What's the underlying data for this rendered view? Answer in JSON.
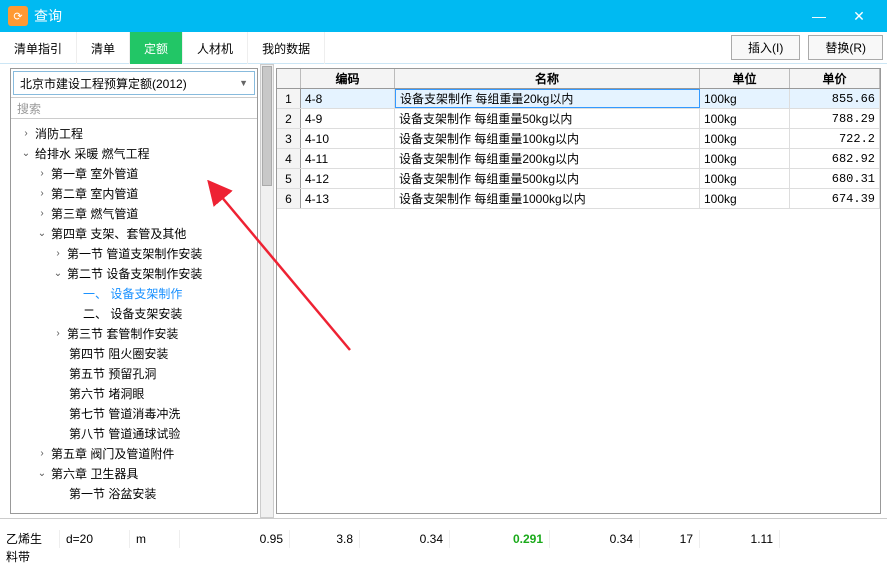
{
  "window": {
    "title": "查询",
    "minimize": "—",
    "close": "✕"
  },
  "tabs": {
    "t1": "清单指引",
    "t2": "清单",
    "t3": "定额",
    "t4": "人材机",
    "t5": "我的数据"
  },
  "actions": {
    "insert": "插入(I)",
    "replace": "替换(R)"
  },
  "dropdown": {
    "value": "北京市建设工程预算定额(2012)"
  },
  "search": {
    "placeholder": "搜索"
  },
  "tree": {
    "n1": "消防工程",
    "n2": "给排水 采暖 燃气工程",
    "n3": "第一章  室外管道",
    "n4": "第二章  室内管道",
    "n5": "第三章  燃气管道",
    "n6": "第四章  支架、套管及其他",
    "n7": "第一节  管道支架制作安装",
    "n8": "第二节  设备支架制作安装",
    "n9": "一、 设备支架制作",
    "n10": "二、 设备支架安装",
    "n11": "第三节  套管制作安装",
    "n12": "第四节  阻火圈安装",
    "n13": "第五节  预留孔洞",
    "n14": "第六节  堵洞眼",
    "n15": "第七节  管道消毒冲洗",
    "n16": "第八节  管道通球试验",
    "n17": "第五章  阀门及管道附件",
    "n18": "第六章  卫生器具",
    "n19": "第一节  浴盆安装"
  },
  "grid": {
    "headers": {
      "num": "",
      "code": "编码",
      "name": "名称",
      "unit": "单位",
      "price": "单价"
    },
    "rows": [
      {
        "n": "1",
        "code": "4-8",
        "name": "设备支架制作  每组重量20kg以内",
        "unit": "100kg",
        "price": "855.66"
      },
      {
        "n": "2",
        "code": "4-9",
        "name": "设备支架制作  每组重量50kg以内",
        "unit": "100kg",
        "price": "788.29"
      },
      {
        "n": "3",
        "code": "4-10",
        "name": "设备支架制作  每组重量100kg以内",
        "unit": "100kg",
        "price": "722.2"
      },
      {
        "n": "4",
        "code": "4-11",
        "name": "设备支架制作  每组重量200kg以内",
        "unit": "100kg",
        "price": "682.92"
      },
      {
        "n": "5",
        "code": "4-12",
        "name": "设备支架制作  每组重量500kg以内",
        "unit": "100kg",
        "price": "680.31"
      },
      {
        "n": "6",
        "code": "4-13",
        "name": "设备支架制作 每组重量1000kg以内",
        "unit": "100kg",
        "price": "674.39"
      }
    ]
  },
  "bottom": {
    "label1": "乙烯生料带",
    "v1": "d=20",
    "v2": "m",
    "v3": "0.95",
    "v4": "3.8",
    "v5": "0.34",
    "v6": "0.291",
    "v7": "0.34",
    "v8": "17",
    "v9": "1.11"
  }
}
